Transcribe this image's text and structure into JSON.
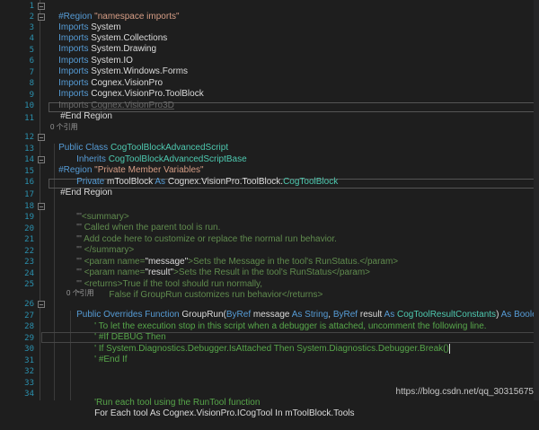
{
  "lines": [
    {
      "num": "1"
    },
    {
      "num": "2"
    },
    {
      "num": "3"
    },
    {
      "num": "4"
    },
    {
      "num": "5"
    },
    {
      "num": "6"
    },
    {
      "num": "7"
    },
    {
      "num": "8"
    },
    {
      "num": "9"
    },
    {
      "num": "10"
    },
    {
      "num": "11"
    },
    {
      "num": "12"
    },
    {
      "num": "13"
    },
    {
      "num": "14"
    },
    {
      "num": "15"
    },
    {
      "num": "16"
    },
    {
      "num": "17"
    },
    {
      "num": "18"
    },
    {
      "num": "19"
    },
    {
      "num": "20"
    },
    {
      "num": "21"
    },
    {
      "num": "22"
    },
    {
      "num": "23"
    },
    {
      "num": "24"
    },
    {
      "num": "25"
    },
    {
      "num": "26"
    },
    {
      "num": "27"
    },
    {
      "num": "28"
    },
    {
      "num": "29"
    },
    {
      "num": "30"
    },
    {
      "num": "31"
    },
    {
      "num": "32"
    },
    {
      "num": "33"
    },
    {
      "num": "34"
    }
  ],
  "code": {
    "l1_kw": "#Region ",
    "l1_str": "\"namespace imports\"",
    "l2_kw": "Imports ",
    "l2_ns": "System",
    "l3_kw": "Imports ",
    "l3_ns": "System.Collections",
    "l4_kw": "Imports ",
    "l4_ns": "System.Drawing",
    "l5_kw": "Imports ",
    "l5_ns": "System.IO",
    "l6_kw": "Imports ",
    "l6_ns": "System.Windows.Forms",
    "l7_kw": "Imports ",
    "l7_ns": "Cognex.VisionPro",
    "l8_kw": "Imports ",
    "l8_ns": "Cognex.VisionPro.ToolBlock",
    "l9_kw": "Imports ",
    "l9_ns": "Cognex.VisionPro3D",
    "l10": "#End Region",
    "lens1": "0 个引用",
    "l12_kw": "Public Class ",
    "l12_ty": "CogToolBlockAdvancedScript",
    "l13_kw": "Inherits ",
    "l13_ty": "CogToolBlockAdvancedScriptBase",
    "l14_kw": "#Region ",
    "l14_str": "\"Private Member Variables\"",
    "l15_kw1": "Private ",
    "l15_id": "mToolBlock ",
    "l15_kw2": "As ",
    "l15_ns": "Cognex.VisionPro.ToolBlock.",
    "l15_ty": "CogToolBlock",
    "l16": "#End Region",
    "l18_a": "'''",
    "l18_b": "<summary>",
    "l19_a": "''' ",
    "l19_b": "Called when the parent tool is run.",
    "l20_a": "''' ",
    "l20_b": "Add code here to customize or replace the normal run behavior.",
    "l21_a": "''' ",
    "l21_b": "</summary>",
    "l22_a": "''' ",
    "l22_b": "<param name=",
    "l22_c": "\"message\"",
    "l22_d": ">Sets the Message in the tool's RunStatus.</param>",
    "l23_a": "''' ",
    "l23_b": "<param name=",
    "l23_c": "\"result\"",
    "l23_d": ">Sets the Result in the tool's RunStatus</param>",
    "l24_a": "''' ",
    "l24_b": "<returns>True if the tool should run normally,",
    "l25_a": "'''           ",
    "l25_b": "False if GroupRun customizes run behavior</returns>",
    "lens2": "0 个引用",
    "l26_kw1": "Public Overrides Function ",
    "l26_id": "GroupRun(",
    "l26_kw2": "ByRef ",
    "l26_p1": "message ",
    "l26_kw3": "As ",
    "l26_kw4": "String",
    "l26_c1": ", ",
    "l26_kw5": "ByRef ",
    "l26_p2": "result ",
    "l26_kw6": "As ",
    "l26_ty": "CogToolResultConstants",
    "l26_c2": ") ",
    "l26_kw7": "As ",
    "l26_kw8": "Boolean",
    "l27": "' To let the execution stop in this script when a debugger is attached, uncomment the following line.",
    "l28": "' #If DEBUG Then",
    "l29": "' If System.Diagnostics.Debugger.IsAttached Then System.Diagnostics.Debugger.Break()",
    "l30": "' #End If",
    "l34": "'Run each tool using the RunTool function",
    "l35": "For Each tool As Cognex.VisionPro.ICogTool In mToolBlock.Tools"
  },
  "watermark": "https://blog.csdn.net/qq_30315675"
}
